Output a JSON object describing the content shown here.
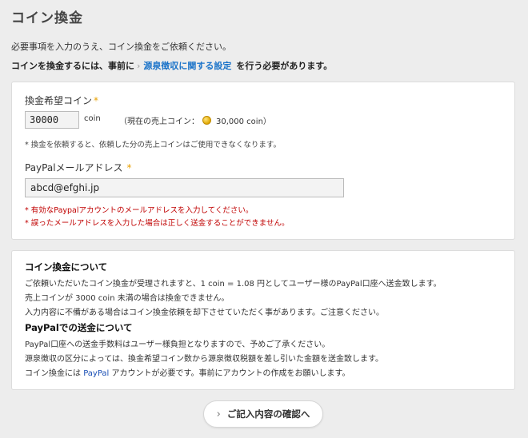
{
  "page": {
    "title": "コイン換金",
    "intro": "必要事項を入力のうえ、コイン換金をご依頼ください。",
    "notice": {
      "prefix": "コインを換金するには、事前に",
      "link_label": "源泉徴収に関する設定",
      "suffix": "を行う必要があります。"
    }
  },
  "form": {
    "coin_label": "換金希望コイン",
    "required_mark": "*",
    "coin_value": "30000",
    "coin_unit": "coin",
    "current_prefix": "（現在の売上コイン：",
    "current_value": "30,000 coin）",
    "coin_note": "* 換金を依頼すると、依頼した分の売上コインはご使用できなくなります。",
    "email_label": "PayPalメールアドレス",
    "email_value": "abcd@efghi.jp",
    "warn1": "* 有効なPaypalアカウントのメールアドレスを入力してください。",
    "warn2": "* 誤ったメールアドレスを入力した場合は正しく送金することができません。"
  },
  "info": {
    "h1": "コイン換金について",
    "p1": "ご依頼いただいたコイン換金が受理されますと、1 coin = 1.08 円としてユーザー様のPayPal口座へ送金致します。",
    "p2": "売上コインが 3000 coin 未満の場合は換金できません。",
    "p3": "入力内容に不備がある場合はコイン換金依頼を却下させていただく事があります。ご注意ください。",
    "h2": "PayPalでの送金について",
    "p4": "PayPal口座への送金手数料はユーザー様負担となりますので、予めご了承ください。",
    "p5": "源泉徴収の区分によっては、換金希望コイン数から源泉徴収税額を差し引いた金額を送金致します。",
    "p6_prefix": "コイン換金には",
    "p6_link": "PayPal",
    "p6_suffix": "アカウントが必要です。事前にアカウントの作成をお願いします。"
  },
  "confirm_button": "ご記入内容の確認へ",
  "colors": {
    "link": "#1a73c9",
    "warning": "#c00000",
    "required": "#e8a000"
  }
}
